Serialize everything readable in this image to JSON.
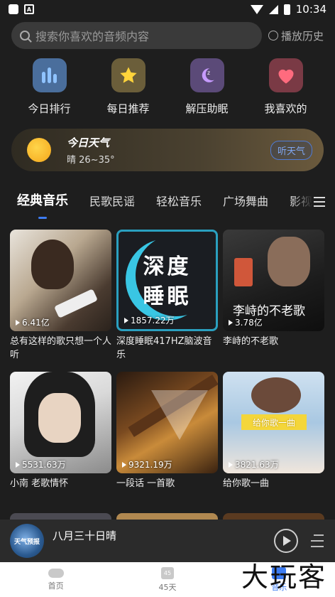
{
  "status_bar": {
    "time": "10:34"
  },
  "search": {
    "placeholder": "搜索你喜欢的音频内容",
    "history_label": "播放历史"
  },
  "quick_links": [
    {
      "label": "今日排行",
      "icon": "chart-bars-icon",
      "color": "#4a6e9c"
    },
    {
      "label": "每日推荐",
      "icon": "star-icon",
      "color": "#6b5e3a"
    },
    {
      "label": "解压助眠",
      "icon": "moon-icon",
      "color": "#5b4a78"
    },
    {
      "label": "我喜欢的",
      "icon": "heart-icon",
      "color": "#7a3a45"
    }
  ],
  "weather": {
    "title": "今日天气",
    "desc": "晴 26~35°",
    "button": "听天气"
  },
  "tabs": [
    "经典音乐",
    "民歌民谣",
    "轻松音乐",
    "广场舞曲",
    "影视"
  ],
  "cards": [
    {
      "plays": "6.41亿",
      "title": "总有这样的歌只想一个人听"
    },
    {
      "plays": "1857.22万",
      "title": "深度睡眠417HZ脑波音乐",
      "cover_text": [
        "深度",
        "睡眠"
      ]
    },
    {
      "plays": "3.78亿",
      "title": "李峙的不老歌",
      "cover_text": "李峙的不老歌"
    },
    {
      "plays": "5531.63万",
      "title": "小南 老歌情怀"
    },
    {
      "plays": "9321.19万",
      "title": "一段话 一首歌"
    },
    {
      "plays": "3821.63万",
      "title": "给你歌一曲",
      "cover_text": "给你歌一曲"
    }
  ],
  "player": {
    "title": "八月三十日晴",
    "disc_text": "天气预报"
  },
  "bottom_nav": [
    {
      "label": "首页",
      "icon": "cloud-icon"
    },
    {
      "label": "45天",
      "icon": "calendar-icon",
      "icon_text": "45"
    },
    {
      "label": "音乐",
      "icon": "music-icon"
    }
  ],
  "watermark": "大玩客"
}
